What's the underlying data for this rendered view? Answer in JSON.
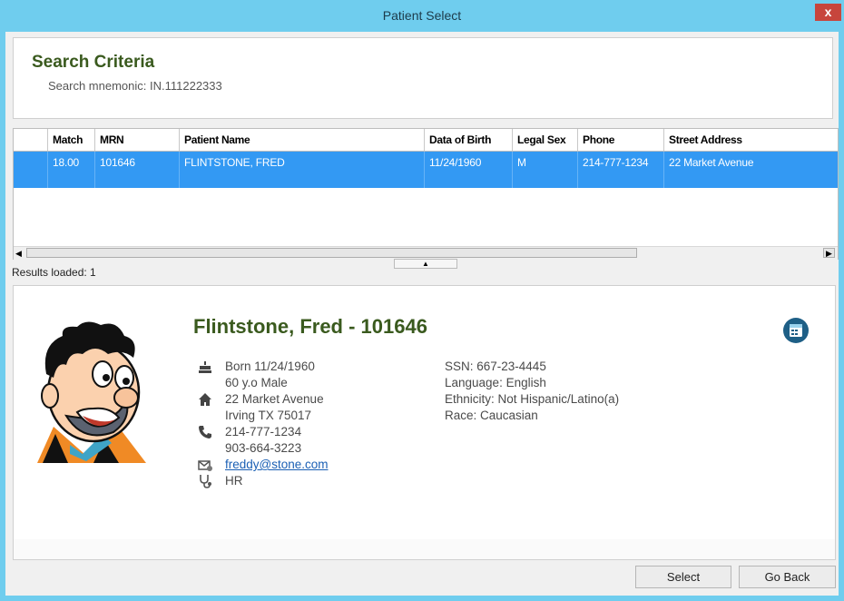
{
  "window": {
    "title": "Patient Select",
    "close_label": "x"
  },
  "search": {
    "title": "Search Criteria",
    "mnemonic": "Search mnemonic: IN.111222333"
  },
  "grid": {
    "headers": [
      "",
      "Match",
      "MRN",
      "Patient Name",
      "Data of Birth",
      "Legal Sex",
      "Phone",
      "Street Address"
    ],
    "rows": [
      {
        "select": "",
        "match": "18.00",
        "mrn": "101646",
        "name": "FLINTSTONE, FRED",
        "dob": "11/24/1960",
        "sex": "M",
        "phone": "214-777-1234",
        "address": "22 Market Avenue"
      }
    ]
  },
  "results_loaded": "Results loaded: 1",
  "detail": {
    "header": "Flintstone, Fred - 101646",
    "born": "Born 11/24/1960",
    "age_sex": "60 y.o Male",
    "street": "22 Market Avenue",
    "city": "Irving TX 75017",
    "phone1": "214-777-1234",
    "phone2": "903-664-3223",
    "email": "freddy@stone.com",
    "provider": "HR",
    "ssn": "SSN: 667-23-4445",
    "language": "Language: English",
    "ethnicity": "Ethnicity: Not Hispanic/Latino(a)",
    "race": "Race: Caucasian"
  },
  "buttons": {
    "select": "Select",
    "go_back": "Go Back"
  },
  "icons": {
    "birth": "cake-icon",
    "home": "home-icon",
    "phone": "phone-icon",
    "email": "email-icon",
    "provider": "stethoscope-icon",
    "calendar": "calendar-icon"
  },
  "colors": {
    "title_bar": "#6fcdee",
    "accent_green": "#3a5a1e",
    "selection": "#3399f3",
    "close": "#c7453c"
  }
}
